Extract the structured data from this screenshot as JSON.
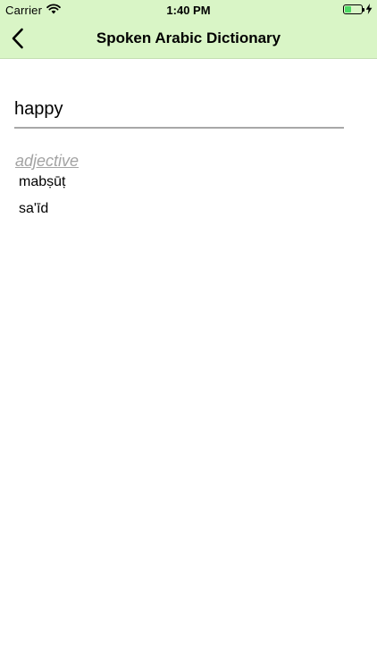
{
  "status_bar": {
    "carrier": "Carrier",
    "time": "1:40 PM",
    "battery_level": 0.35
  },
  "nav": {
    "title": "Spoken Arabic Dictionary",
    "back_icon": "chevron-left-icon"
  },
  "search": {
    "value": "happy"
  },
  "results": {
    "part_of_speech": "adjective",
    "words": [
      "mabṣūṭ",
      "sa'īd"
    ]
  },
  "colors": {
    "nav_background": "#d9f5c6",
    "pos_label": "#a3a3a3",
    "underline": "#a8a8a8",
    "battery_fill": "#4cd964"
  }
}
